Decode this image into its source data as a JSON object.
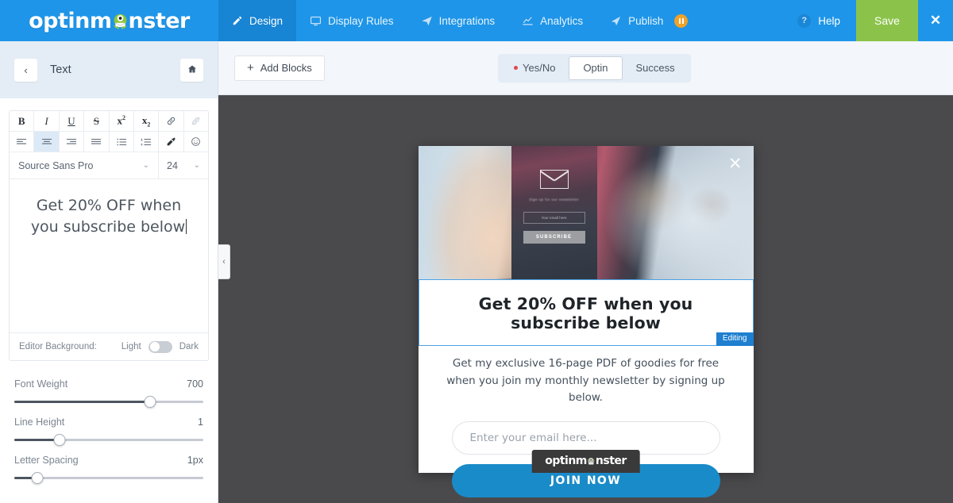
{
  "app": {
    "logo_text_left": "optinm",
    "logo_text_right": "nster",
    "logo_icon": "monster-icon"
  },
  "topnav": {
    "items": [
      {
        "label": "Design",
        "icon": "pencil-icon",
        "active": true
      },
      {
        "label": "Display Rules",
        "icon": "monitor-icon",
        "active": false
      },
      {
        "label": "Integrations",
        "icon": "paper-plane-icon",
        "active": false
      },
      {
        "label": "Analytics",
        "icon": "chart-line-icon",
        "active": false
      },
      {
        "label": "Publish",
        "icon": "rocket-icon",
        "active": false,
        "badge": "pause-icon"
      }
    ],
    "help_label": "Help",
    "help_icon": "question-mark-icon",
    "save_label": "Save",
    "close_icon": "close-icon",
    "colors": {
      "bar": "#1e95e8",
      "active": "#1784d4",
      "save": "#8bc34a",
      "badge": "#f0a229"
    }
  },
  "sidebar": {
    "back_icon": "chevron-left-icon",
    "title": "Text",
    "home_icon": "home-icon",
    "toolbar_row1": [
      {
        "label": "B",
        "name": "bold-button",
        "state": "normal"
      },
      {
        "label": "I",
        "name": "italic-button",
        "state": "normal"
      },
      {
        "label": "U",
        "name": "underline-button",
        "state": "normal"
      },
      {
        "label": "S",
        "name": "strikethrough-button",
        "state": "normal"
      },
      {
        "label": "x2",
        "name": "superscript-button",
        "state": "normal"
      },
      {
        "label": "x2",
        "name": "subscript-button",
        "state": "normal"
      },
      {
        "label": "",
        "name": "link-button",
        "state": "normal"
      },
      {
        "label": "",
        "name": "unlink-button",
        "state": "disabled"
      }
    ],
    "toolbar_row2": [
      {
        "name": "align-left-button",
        "state": "normal"
      },
      {
        "name": "align-center-button",
        "state": "active"
      },
      {
        "name": "align-right-button",
        "state": "normal"
      },
      {
        "name": "align-justify-button",
        "state": "normal"
      },
      {
        "name": "bullet-list-button",
        "state": "normal"
      },
      {
        "name": "numbered-list-button",
        "state": "normal"
      },
      {
        "name": "color-picker-button",
        "state": "normal"
      },
      {
        "name": "emoji-button",
        "state": "normal"
      }
    ],
    "font_family": "Source Sans Pro",
    "font_size": "24",
    "editor_text": "Get 20% OFF when you subscribe below",
    "editor_background_label": "Editor Background:",
    "editor_bg_light": "Light",
    "editor_bg_dark": "Dark",
    "sliders": [
      {
        "label": "Font Weight",
        "value": "700",
        "percent": 72
      },
      {
        "label": "Line Height",
        "value": "1",
        "percent": 24
      },
      {
        "label": "Letter Spacing",
        "value": "1px",
        "percent": 12
      }
    ]
  },
  "canvas_bar": {
    "add_blocks_label": "Add Blocks",
    "add_blocks_icon": "plus-icon",
    "tabs": [
      {
        "label": "Yes/No",
        "active": false,
        "dot": true
      },
      {
        "label": "Optin",
        "active": true,
        "dot": false
      },
      {
        "label": "Success",
        "active": false,
        "dot": false
      }
    ]
  },
  "canvas": {
    "collapse_icon": "chevron-left-icon",
    "background_color": "#4a4a4d"
  },
  "popup": {
    "close_icon": "close-icon",
    "hero_image_alt": "hand-holding-phone-newsletter-photo",
    "phone": {
      "envelope_icon": "envelope-icon",
      "caption": "Sign up for our newsletter",
      "input_placeholder": "Your email here",
      "button_label": "SUBSCRIBE"
    },
    "headline": "Get 20% OFF when you subscribe below",
    "editing_badge": "Editing",
    "subtext": "Get my exclusive 16-page PDF of goodies for free when you join my monthly newsletter by signing up below.",
    "email_placeholder": "Enter your email here...",
    "submit_label": "JOIN NOW",
    "footer_logo_left": "optinm",
    "footer_logo_right": "nster",
    "accent_color": "#1a8bc9",
    "editing_badge_color": "#1f7fd0"
  }
}
